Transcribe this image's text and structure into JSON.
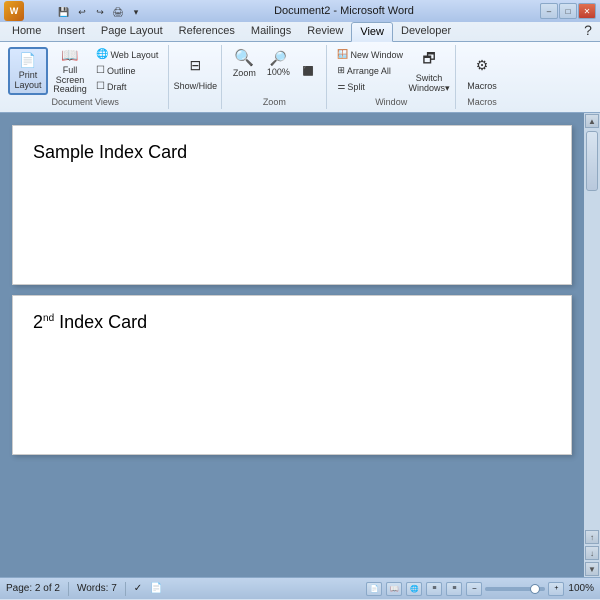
{
  "titlebar": {
    "title": "Document2 - Microsoft Word",
    "minimize": "–",
    "maximize": "□",
    "close": "✕"
  },
  "ribbon": {
    "tabs": [
      "Home",
      "Insert",
      "Page Layout",
      "References",
      "Mailings",
      "Review",
      "View",
      "Developer"
    ],
    "active_tab": "View",
    "groups": {
      "document_views": {
        "label": "Document Views",
        "buttons": [
          {
            "id": "print-layout",
            "label": "Print\nLayout",
            "active": true
          },
          {
            "id": "full-screen-reading",
            "label": "Full Screen\nReading",
            "active": false
          }
        ],
        "small_buttons": [
          "Web Layout",
          "Outline",
          "Draft"
        ]
      },
      "show_hide": {
        "label": "Show/Hide",
        "button": "Show/Hide"
      },
      "zoom": {
        "label": "Zoom",
        "buttons": [
          "Zoom",
          "100%"
        ]
      },
      "window": {
        "label": "Window",
        "buttons": [
          "New Window",
          "Arrange All",
          "Split",
          "Switch Windows"
        ]
      },
      "macros": {
        "label": "Macros",
        "button": "Macros"
      }
    }
  },
  "document": {
    "card1": {
      "title": "Sample Index Card"
    },
    "card2": {
      "title_prefix": "2",
      "title_sup": "nd",
      "title_suffix": " Index Card"
    }
  },
  "statusbar": {
    "page": "Page: 2 of 2",
    "words": "Words: 7",
    "zoom_level": "100%",
    "zoom_minus": "–",
    "zoom_plus": "+"
  }
}
